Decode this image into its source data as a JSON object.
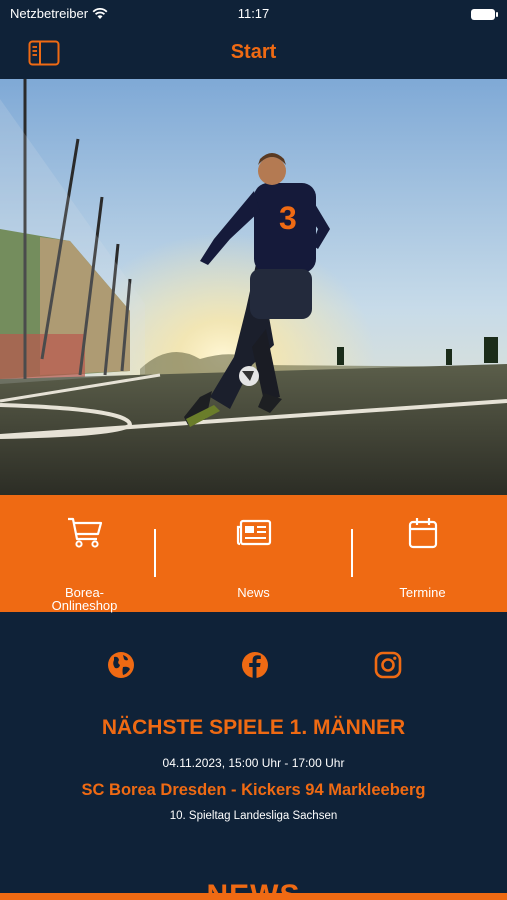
{
  "status_bar": {
    "carrier": "Netzbetreiber",
    "time": "11:17"
  },
  "nav": {
    "title": "Start",
    "menu_icon": "sidebar-icon"
  },
  "hero": {
    "image_icon": "football-player-photo",
    "jersey_number": "3"
  },
  "quick_links": [
    {
      "label": "Borea-\nOnlineshop",
      "icon": "cart-icon"
    },
    {
      "label": "News",
      "icon": "newspaper-icon"
    },
    {
      "label": "Termine",
      "icon": "calendar-icon"
    }
  ],
  "social": [
    {
      "icon": "globe-icon"
    },
    {
      "icon": "facebook-icon"
    },
    {
      "icon": "instagram-icon"
    }
  ],
  "next_matches": {
    "title": "NÄCHSTE SPIELE 1. MÄNNER",
    "date": "04.11.2023, 15:00 Uhr - 17:00 Uhr",
    "teams": "SC Borea Dresden - Kickers 94 Markleeberg",
    "league": "10. Spieltag Landesliga Sachsen"
  },
  "news_heading": "NEWS",
  "colors": {
    "navy": "#0f2238",
    "orange": "#ef6a13"
  }
}
